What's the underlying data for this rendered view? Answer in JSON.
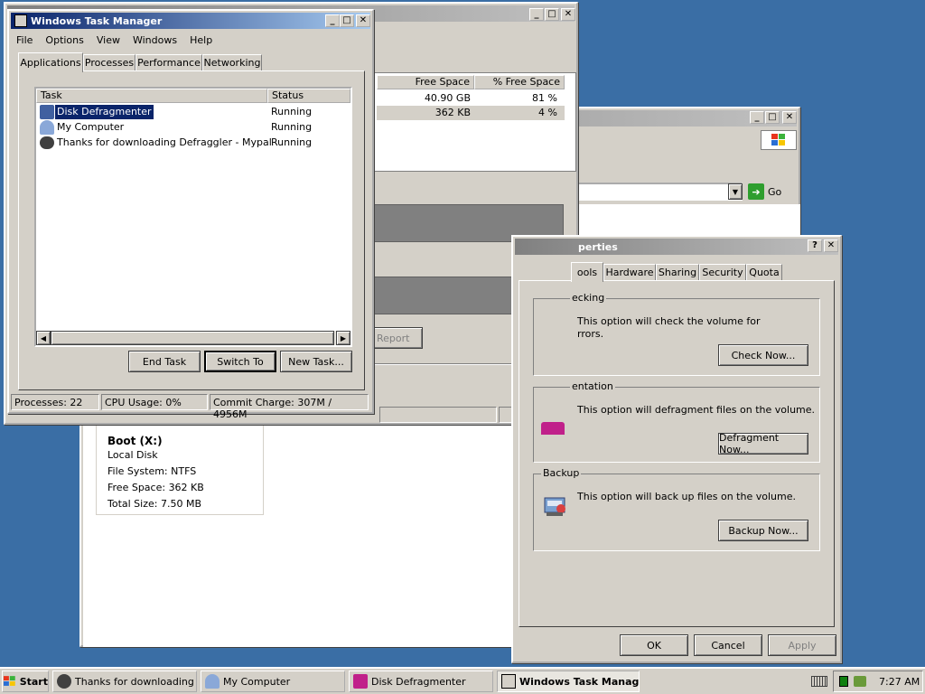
{
  "tm": {
    "title": "Windows Task Manager",
    "menu": [
      "File",
      "Options",
      "View",
      "Windows",
      "Help"
    ],
    "tabs": [
      "Applications",
      "Processes",
      "Performance",
      "Networking"
    ],
    "headers": {
      "task": "Task",
      "status": "Status"
    },
    "rows": [
      {
        "task": "Disk Defragmenter",
        "status": "Running"
      },
      {
        "task": "My Computer",
        "status": "Running"
      },
      {
        "task": "Thanks for downloading Defraggler - Mypal",
        "status": "Running"
      }
    ],
    "buttons": {
      "end": "End Task",
      "switch": "Switch To",
      "new": "New Task..."
    },
    "statusbar": {
      "processes": "Processes: 22",
      "cpu": "CPU Usage: 0%",
      "commit": "Commit Charge: 307M / 4956M"
    }
  },
  "defrag": {
    "headers": {
      "free": "Free Space",
      "pct": "% Free Space"
    },
    "rows": [
      {
        "free": "40.90 GB",
        "pct": "81 %"
      },
      {
        "free": "362 KB",
        "pct": "4 %"
      }
    ],
    "report_btn": "Report"
  },
  "mycomp": {
    "go": "Go",
    "drive": {
      "name": "Boot (X:)",
      "type": "Local Disk",
      "fs": "File System: NTFS",
      "free": "Free Space: 362 KB",
      "total": "Total Size: 7.50 MB"
    }
  },
  "props": {
    "title": "perties",
    "tabs": [
      "ools",
      "Hardware",
      "Sharing",
      "Security",
      "Quota"
    ],
    "check": {
      "label": "ecking",
      "text1": "This option will check the volume for",
      "text2": "rrors.",
      "btn": "Check Now..."
    },
    "defrag": {
      "label": "entation",
      "text": "This option will defragment files on the volume.",
      "btn": "Defragment Now..."
    },
    "backup": {
      "label": "Backup",
      "text": "This option will back up files on the volume.",
      "btn": "Backup Now..."
    },
    "ok": "OK",
    "cancel": "Cancel",
    "apply": "Apply"
  },
  "taskbar": {
    "start": "Start",
    "items": [
      "Thanks for downloading ...",
      "My Computer",
      "Disk Defragmenter",
      "Windows Task Manag..."
    ],
    "time": "7:27 AM"
  }
}
